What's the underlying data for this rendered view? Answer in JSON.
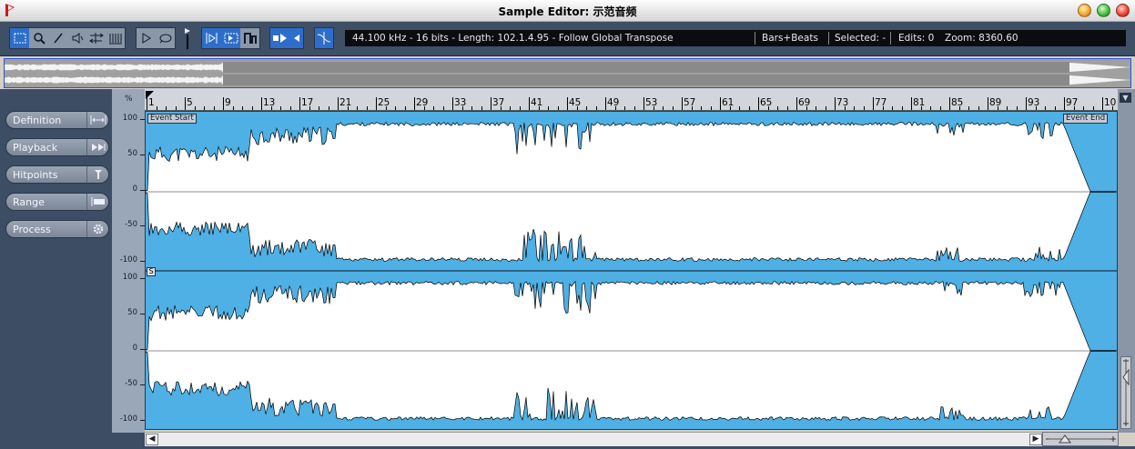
{
  "window": {
    "title": "Sample Editor: 示范音频",
    "icon": "cubase-app-icon"
  },
  "toolbar": {
    "tools": [
      {
        "name": "range-selection-tool",
        "icon": "⬚",
        "active": true
      },
      {
        "name": "zoom-tool",
        "icon": "🔍",
        "active": false
      },
      {
        "name": "pencil-tool",
        "icon": "✎",
        "active": false
      },
      {
        "name": "audition-tool",
        "icon": "🔈",
        "active": false
      },
      {
        "name": "warp-tool",
        "icon": "⇆",
        "active": false
      },
      {
        "name": "hitpoint-tool",
        "icon": "┃┃",
        "active": false
      }
    ],
    "play_tools": [
      {
        "name": "play-button",
        "icon": "▷"
      },
      {
        "name": "loop-button",
        "icon": "◯"
      }
    ],
    "snap_tools": [
      {
        "name": "snap-to-zero-button",
        "icon": "⊳",
        "active": true
      },
      {
        "name": "auto-scroll-button",
        "icon": "▦",
        "active": true
      },
      {
        "name": "show-regions-button",
        "icon": "▟",
        "active": false
      }
    ],
    "nav_tools": [
      {
        "name": "event-nudge-button",
        "icon": "▶",
        "active": true
      },
      {
        "name": "event-nudge-left-button",
        "icon": "◀",
        "active": true
      }
    ],
    "zero_cross_icon": "zero-crossing-icon",
    "info": {
      "format": "44.100 kHz - 16 bits - Length: 102.1.4.95 - Follow Global Transpose",
      "time_format": "Bars+Beats",
      "selected": "Selected: -",
      "edits": "Edits: 0",
      "zoom": "Zoom: 8360.60"
    }
  },
  "sidebar": {
    "items": [
      {
        "label": "Definition",
        "icon": "definition-icon",
        "glyph": "|↔|"
      },
      {
        "label": "Playback",
        "icon": "playback-icon",
        "glyph": "▶▶"
      },
      {
        "label": "Hitpoints",
        "icon": "hitpoints-icon",
        "glyph": "T"
      },
      {
        "label": "Range",
        "icon": "range-icon",
        "glyph": "▐▬"
      },
      {
        "label": "Process",
        "icon": "gear-icon",
        "glyph": "⚙"
      }
    ]
  },
  "scale": {
    "unit": "%",
    "labels": [
      "100",
      "50",
      "0",
      "-50",
      "-100"
    ]
  },
  "ruler": {
    "bars": [
      "1",
      "5",
      "9",
      "13",
      "17",
      "21",
      "25",
      "29",
      "33",
      "37",
      "41",
      "45",
      "49",
      "53",
      "57",
      "61",
      "65",
      "69",
      "73",
      "77",
      "81",
      "85",
      "89",
      "93",
      "97",
      "10"
    ]
  },
  "markers": {
    "event_start": "Event Start",
    "event_end": "Event End",
    "channel_link": "S"
  },
  "colors": {
    "waveform_bg": "#4eb0e4",
    "waveform_fill": "#ffffff",
    "panel_bg": "#3c4d64",
    "active_tool": "#2d6ecb"
  }
}
